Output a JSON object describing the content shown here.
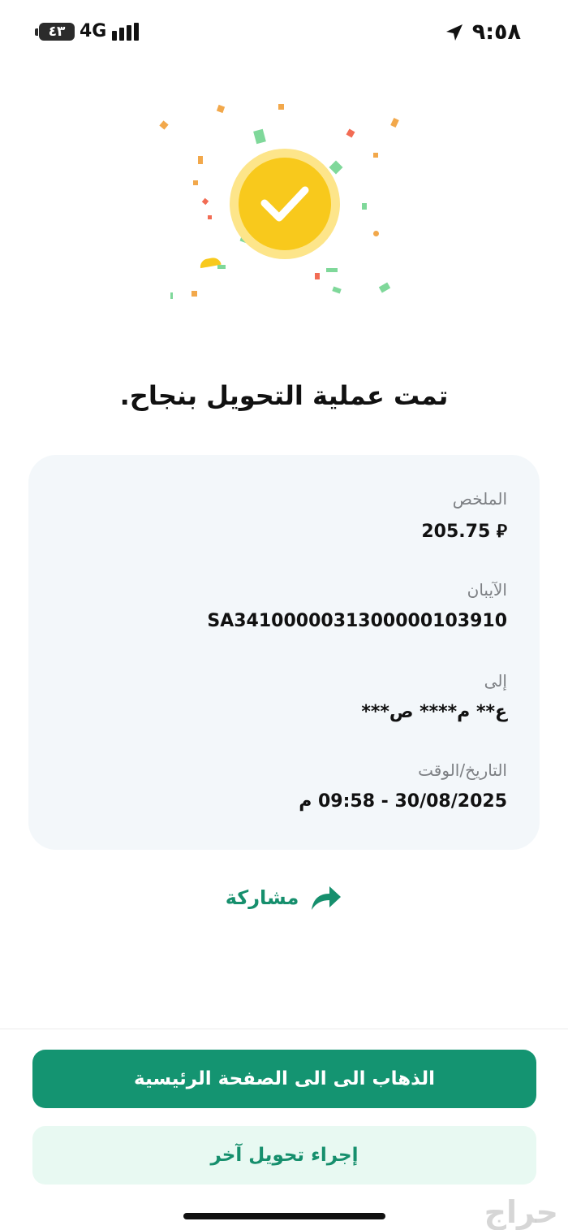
{
  "status_bar": {
    "battery": "٤٣",
    "network": "4G",
    "time": "٩:٥٨",
    "location_icon": "location-arrow-icon"
  },
  "title": "تمت عملية التحويل بنجاح.",
  "summary": {
    "amount_label": "الملخص",
    "amount_value": "205.75 ⃁",
    "iban_label": "الآيبان",
    "iban_value": "SA3410000031300000103910",
    "to_label": "إلى",
    "to_value": "ع** م**** ص***",
    "datetime_label": "التاريخ/الوقت",
    "datetime_value": "30/08/2025 - 09:58 م"
  },
  "share": {
    "label": "مشاركة",
    "icon": "share-arrow-icon"
  },
  "buttons": {
    "home": "الذهاب الى الى الصفحة الرئيسية",
    "another_transfer": "إجراء تحويل آخر"
  },
  "watermark": "حراج",
  "colors": {
    "accent": "#149471",
    "accent_text": "#168f6d",
    "badge": "#f8c91c",
    "card_bg": "#f3f7fa"
  }
}
